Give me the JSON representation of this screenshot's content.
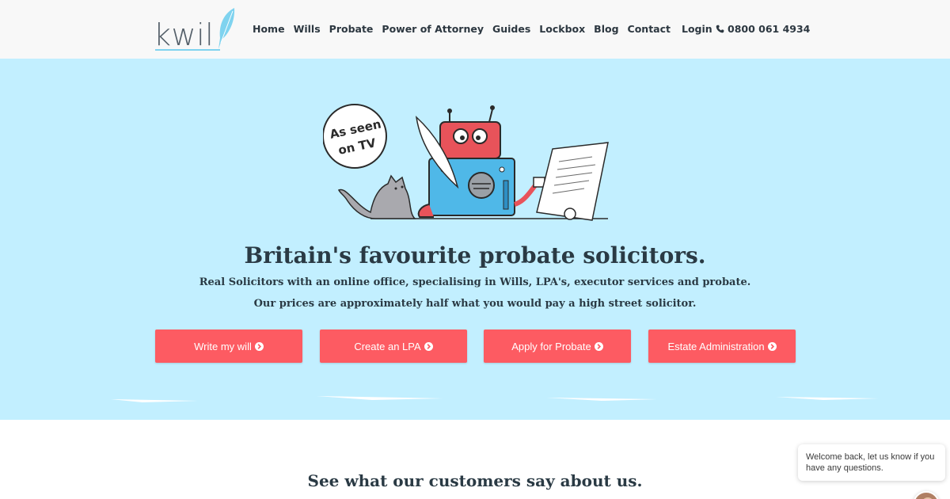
{
  "header": {
    "logo_text": "kwil",
    "nav": [
      "Home",
      "Wills",
      "Probate",
      "Power of Attorney",
      "Guides",
      "Lockbox",
      "Blog",
      "Contact"
    ],
    "login_label": "Login",
    "phone": "0800 061 4934"
  },
  "hero": {
    "badge_line1": "As seen",
    "badge_line2": "on TV",
    "headline": "Britain's favourite probate solicitors.",
    "subline1": "Real Solicitors with an online office, specialising in Wills, LPA's, executor services and probate.",
    "subline2": "Our prices are approximately half what you would pay a high street solicitor.",
    "buttons": [
      "Write my will",
      "Create an LPA",
      "Apply for Probate",
      "Estate Administration"
    ]
  },
  "testimonials": {
    "title": "See what our customers say about us."
  },
  "chat": {
    "message": "Welcome back, let us know if you have any questions."
  },
  "colors": {
    "hero_bg": "#c2efff",
    "cta": "#fd5b62",
    "header_bg": "#f8f8f8",
    "text_dark": "#2a3a44"
  },
  "icons": {
    "phone": "phone-icon",
    "arrow": "arrow-circle-right-icon",
    "quill": "quill-icon"
  }
}
